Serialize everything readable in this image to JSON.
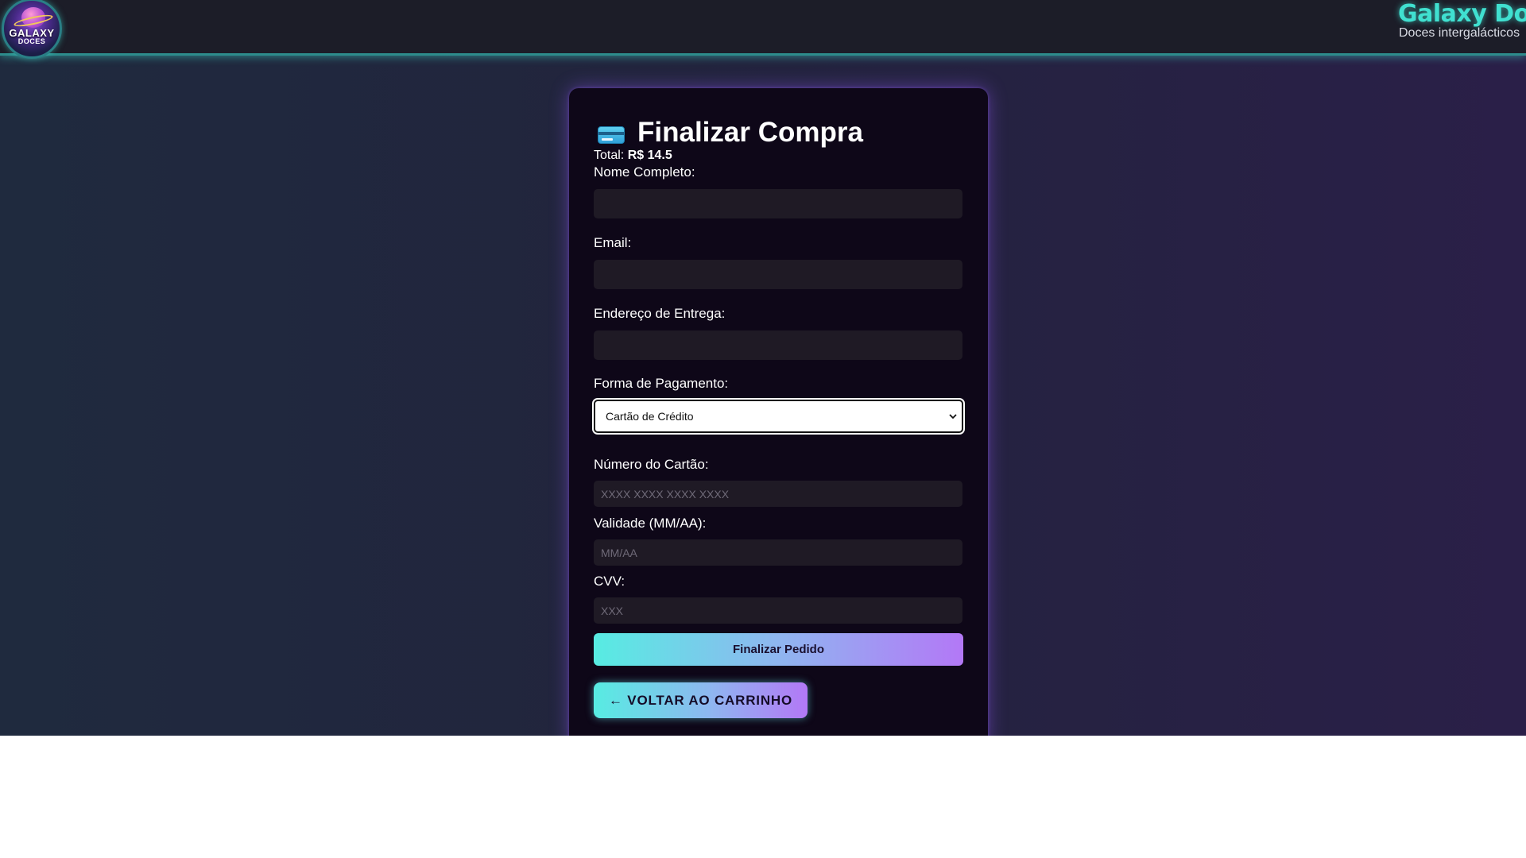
{
  "header": {
    "logo": {
      "line1": "GALAXY",
      "line2": "DOCES"
    },
    "brand_title": "Galaxy Doc",
    "brand_subtitle": "Doces intergalácticos"
  },
  "checkout": {
    "icon": "credit-card-icon",
    "title": "Finalizar Compra",
    "total_label": "Total:",
    "total_value": "R$ 14.5",
    "fields": {
      "name_label": "Nome Completo:",
      "email_label": "Email:",
      "address_label": "Endereço de Entrega:",
      "payment_label": "Forma de Pagamento:",
      "payment_selected": "Cartão de Crédito",
      "card_number_label": "Número do Cartão:",
      "card_number_placeholder": "XXXX XXXX XXXX XXXX",
      "expiry_label": "Validade (MM/AA):",
      "expiry_placeholder": "MM/AA",
      "cvv_label": "CVV:",
      "cvv_placeholder": "XXX"
    },
    "submit_label": "Finalizar Pedido",
    "back_label": "← VOLTAR AO CARRINHO"
  },
  "colors": {
    "accent_cyan": "#40e0d0",
    "accent_purple": "#b378f6",
    "card_bg": "#0e0718",
    "field_bg": "#1f1a25"
  }
}
